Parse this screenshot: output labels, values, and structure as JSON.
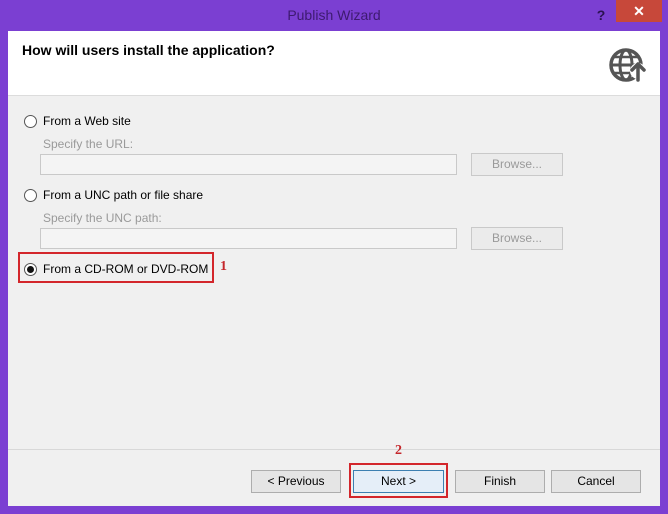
{
  "window": {
    "title": "Publish Wizard",
    "help_label": "?",
    "close_label": "✕"
  },
  "header": {
    "heading": "How will users install the application?",
    "icon": "globe-publish-icon"
  },
  "options": [
    {
      "label": "From a Web site",
      "checked": false,
      "sub_label": "Specify the URL:",
      "value": "",
      "browse_label": "Browse..."
    },
    {
      "label": "From a UNC path or file share",
      "checked": false,
      "sub_label": "Specify the UNC path:",
      "value": "",
      "browse_label": "Browse..."
    },
    {
      "label": "From a CD-ROM or DVD-ROM",
      "checked": true
    }
  ],
  "annotations": {
    "step1": "1",
    "step2": "2",
    "color": "#d3262b"
  },
  "footer": {
    "previous_label": "< Previous",
    "next_label": "Next >",
    "finish_label": "Finish",
    "cancel_label": "Cancel"
  }
}
